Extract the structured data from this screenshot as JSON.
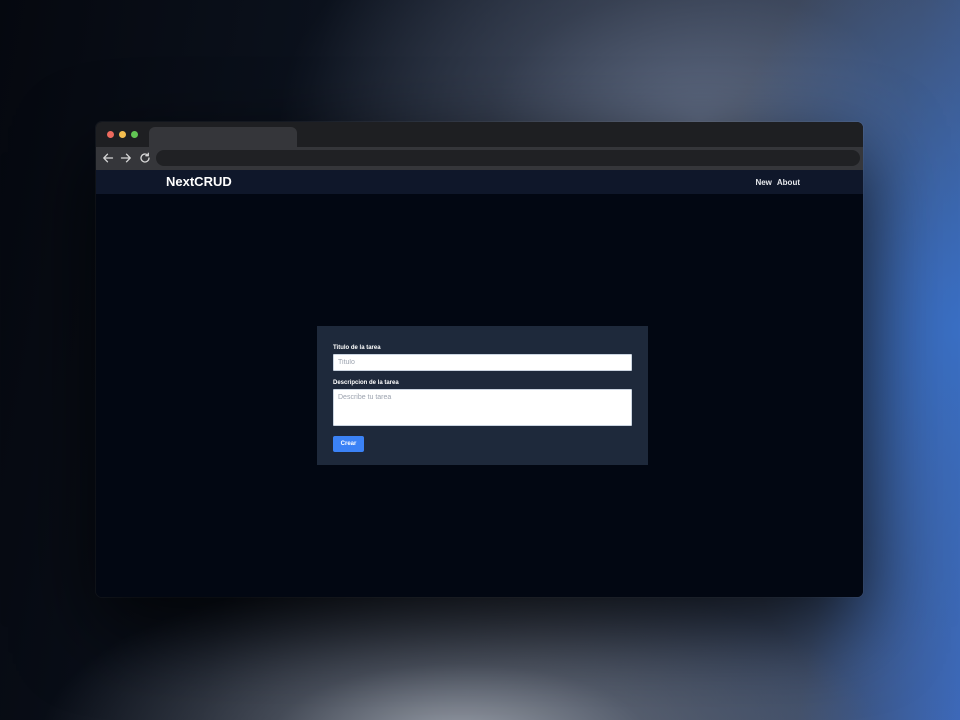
{
  "app": {
    "brand": "NextCRUD",
    "nav": [
      "New",
      "About"
    ]
  },
  "form": {
    "title_label": "Titulo de la tarea",
    "title_placeholder": "Titulo",
    "description_label": "Descripcion de la tarea",
    "description_placeholder": "Describe tu tarea",
    "submit_label": "Crear"
  },
  "colors": {
    "navbar": "#0f172a",
    "page_background": "#020712",
    "card": "#1e293b",
    "accent": "#3b82f6"
  },
  "icons": [
    "back-arrow-icon",
    "forward-arrow-icon",
    "reload-icon"
  ]
}
